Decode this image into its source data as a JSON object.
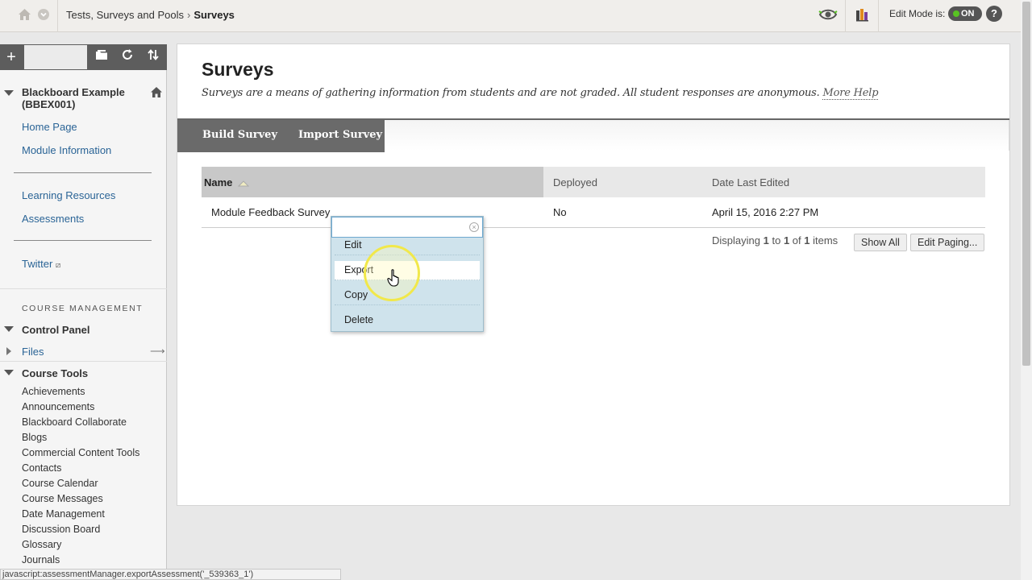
{
  "topbar": {
    "breadcrumb_parent": "Tests, Surveys and Pools",
    "breadcrumb_separator": "›",
    "breadcrumb_current": "Surveys",
    "edit_mode_label": "Edit Mode is:",
    "edit_mode_state": "ON",
    "help_label": "?"
  },
  "sidebar": {
    "toolbar": {
      "add_label": "+"
    },
    "course_title": "Blackboard Example (BBEX001)",
    "links_group1": [
      "Home Page",
      "Module Information"
    ],
    "links_group2": [
      "Learning Resources",
      "Assessments"
    ],
    "links_group3": [
      "Twitter"
    ],
    "course_management_label": "COURSE MANAGEMENT",
    "control_panel_label": "Control Panel",
    "files_label": "Files",
    "course_tools_label": "Course Tools",
    "course_tools": [
      "Achievements",
      "Announcements",
      "Blackboard Collaborate",
      "Blogs",
      "Commercial Content Tools",
      "Contacts",
      "Course Calendar",
      "Course Messages",
      "Date Management",
      "Discussion Board",
      "Glossary",
      "Journals"
    ]
  },
  "main": {
    "title": "Surveys",
    "description": "Surveys are a means of gathering information from students and are not graded. All student responses are anonymous.",
    "more_help": "More Help",
    "actions": {
      "build": "Build Survey",
      "import": "Import Survey"
    },
    "table": {
      "columns": [
        "Name",
        "Deployed",
        "Date Last Edited"
      ],
      "rows": [
        {
          "name": "Module Feedback Survey",
          "deployed": "No",
          "date": "April 15, 2016 2:27 PM"
        }
      ]
    },
    "paging": {
      "prefix": "Displaying",
      "start": "1",
      "to": "to",
      "end": "1",
      "of": "of",
      "total": "1",
      "suffix": "items",
      "show_all": "Show All",
      "edit_paging": "Edit Paging..."
    }
  },
  "context_menu": {
    "items": [
      "Edit",
      "Export",
      "Copy",
      "Delete"
    ],
    "highlighted": "Export"
  },
  "statusbar": {
    "text": "javascript:assessmentManager.exportAssessment('_539363_1')"
  },
  "colors": {
    "link": "#2a6496",
    "menu_bg": "#cfe3ec",
    "action_bar": "#6a6a6a",
    "toggle_on": "#58c322"
  }
}
